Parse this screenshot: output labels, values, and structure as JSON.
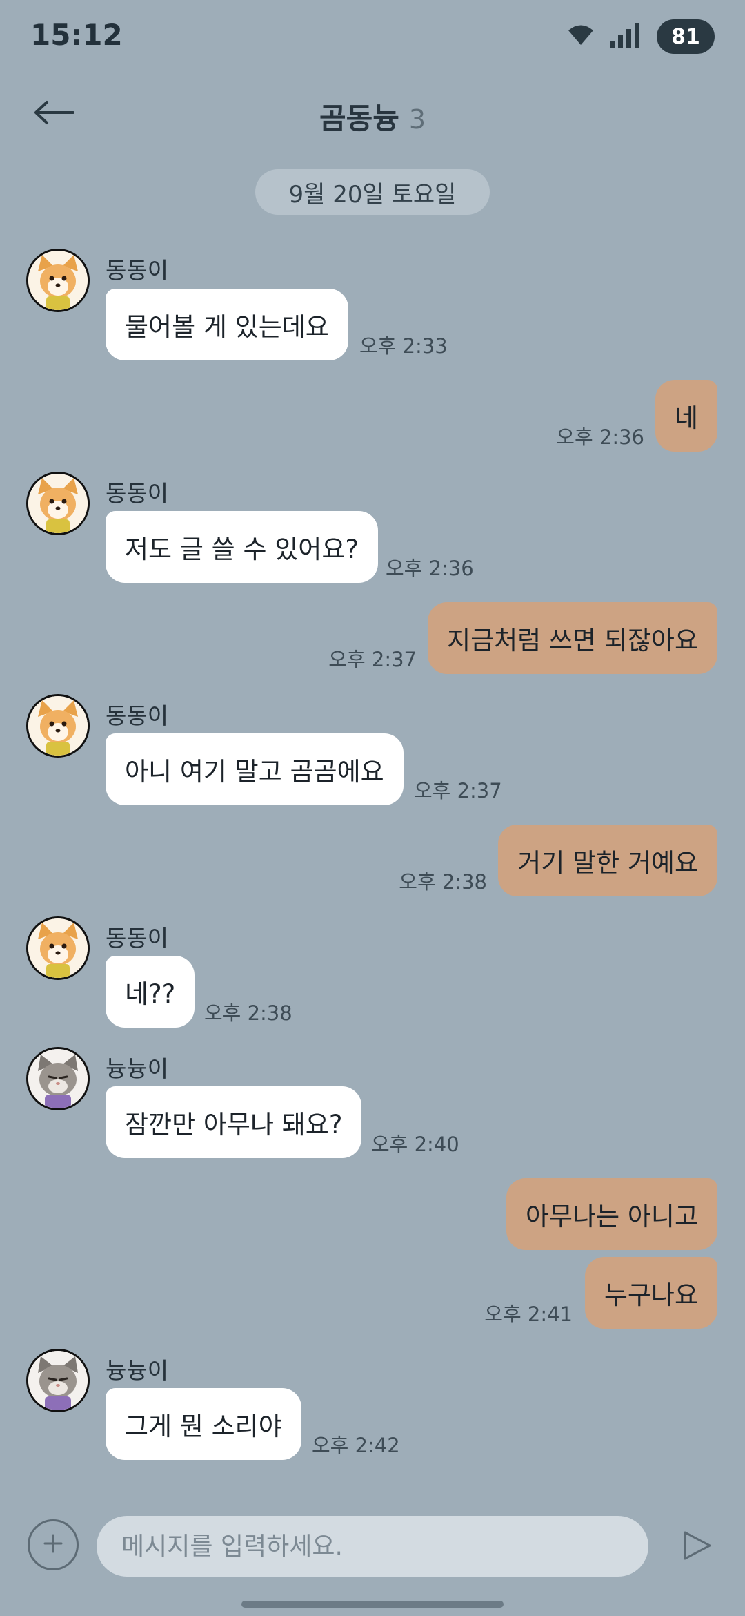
{
  "status_bar": {
    "time": "15:12",
    "battery": "81",
    "icons": [
      "wifi-icon",
      "signal-icon"
    ]
  },
  "header": {
    "title": "곰동늉",
    "member_count": "3",
    "back_icon": "back-arrow-icon"
  },
  "date_separator": "9월 20일 토요일",
  "messages": [
    {
      "direction": "in",
      "sender": "동동이",
      "avatar": "dog",
      "text": "물어볼 게 있는데요",
      "time": "오후 2:33"
    },
    {
      "direction": "out",
      "text": "네",
      "time": "오후 2:36"
    },
    {
      "direction": "in",
      "sender": "동동이",
      "avatar": "dog",
      "text": "저도 글 쓸 수 있어요?",
      "time": "오후 2:36"
    },
    {
      "direction": "out",
      "text": "지금처럼 쓰면 되잖아요",
      "time": "오후 2:37"
    },
    {
      "direction": "in",
      "sender": "동동이",
      "avatar": "dog",
      "text": "아니 여기 말고 곰곰에요",
      "time": "오후 2:37"
    },
    {
      "direction": "out",
      "text": "거기 말한 거예요",
      "time": "오후 2:38"
    },
    {
      "direction": "in",
      "sender": "동동이",
      "avatar": "dog",
      "text": "네??",
      "time": "오후 2:38"
    },
    {
      "direction": "in",
      "sender": "늉늉이",
      "avatar": "cat",
      "text": "잠깐만 아무나 돼요?",
      "time": "오후 2:40"
    },
    {
      "direction": "out",
      "text": "아무나는 아니고",
      "time": ""
    },
    {
      "direction": "out",
      "text": "누구나요",
      "time": "오후 2:41"
    },
    {
      "direction": "in",
      "sender": "늉늉이",
      "avatar": "cat",
      "text": "그게 뭔 소리야",
      "time": "오후 2:42"
    }
  ],
  "input": {
    "placeholder": "메시지를 입력하세요.",
    "value": "",
    "plus_icon": "plus-icon",
    "send_icon": "send-icon"
  },
  "colors": {
    "background": "#9eadb8",
    "incoming_bubble": "#ffffff",
    "outgoing_bubble": "#cda383"
  }
}
